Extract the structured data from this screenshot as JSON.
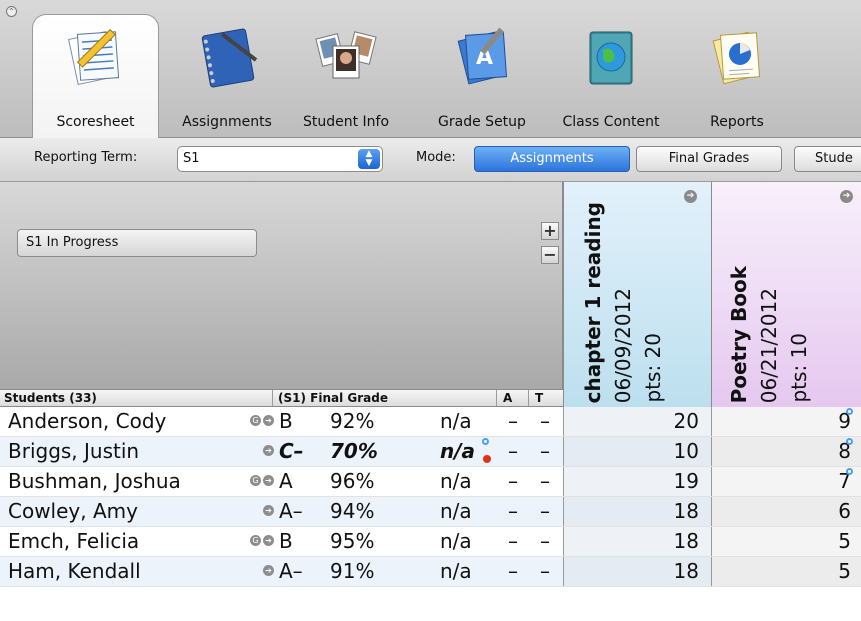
{
  "toolbar": {
    "tabs": [
      {
        "label": "Scoresheet",
        "icon": "scoresheet-icon"
      },
      {
        "label": "Assignments",
        "icon": "assignments-notebook-icon"
      },
      {
        "label": "Student Info",
        "icon": "student-photos-icon"
      },
      {
        "label": "Grade Setup",
        "icon": "grade-setup-icon"
      },
      {
        "label": "Class Content",
        "icon": "class-content-globe-icon"
      },
      {
        "label": "Reports",
        "icon": "reports-pie-chart-icon"
      }
    ],
    "active_tab": "Scoresheet"
  },
  "modebar": {
    "reporting_term_label": "Reporting Term:",
    "reporting_term_value": "S1",
    "mode_label": "Mode:",
    "modes": [
      "Assignments",
      "Final Grades",
      "Stude"
    ],
    "selected_mode": "Assignments"
  },
  "header": {
    "status_button": "S1 In Progress",
    "plus": "+",
    "minus": "−"
  },
  "assignments": [
    {
      "title": "chapter 1 reading",
      "date": "06/09/2012",
      "points": "pts: 20",
      "color": "#bcdfee"
    },
    {
      "title": "Poetry Book",
      "date": "06/21/2012",
      "points": "pts: 10",
      "color": "#e5c8ef"
    }
  ],
  "columns": {
    "students": "Students (33)",
    "final_grade": "(S1) Final Grade",
    "a": "A",
    "t": "T"
  },
  "students": [
    {
      "name": "Anderson, Cody",
      "letter": "B",
      "pct": "92%",
      "na": "n/a",
      "a": "–",
      "t": "–",
      "s1": "20",
      "s2": "9"
    },
    {
      "name": "Briggs, Justin",
      "letter": "C–",
      "pct": "70%",
      "na": "n/a",
      "a": "–",
      "t": "–",
      "s1": "10",
      "s2": "8"
    },
    {
      "name": "Bushman, Joshua",
      "letter": "A",
      "pct": "96%",
      "na": "n/a",
      "a": "–",
      "t": "–",
      "s1": "19",
      "s2": "7"
    },
    {
      "name": "Cowley, Amy",
      "letter": "A–",
      "pct": "94%",
      "na": "n/a",
      "a": "–",
      "t": "–",
      "s1": "18",
      "s2": "6"
    },
    {
      "name": "Emch, Felicia",
      "letter": "B",
      "pct": "95%",
      "na": "n/a",
      "a": "–",
      "t": "–",
      "s1": "18",
      "s2": "5"
    },
    {
      "name": "Ham, Kendall",
      "letter": "A–",
      "pct": "91%",
      "na": "n/a",
      "a": "–",
      "t": "–",
      "s1": "18",
      "s2": "5"
    }
  ],
  "colors": {
    "accent": "#2b74de",
    "alert": "#e0301e"
  }
}
